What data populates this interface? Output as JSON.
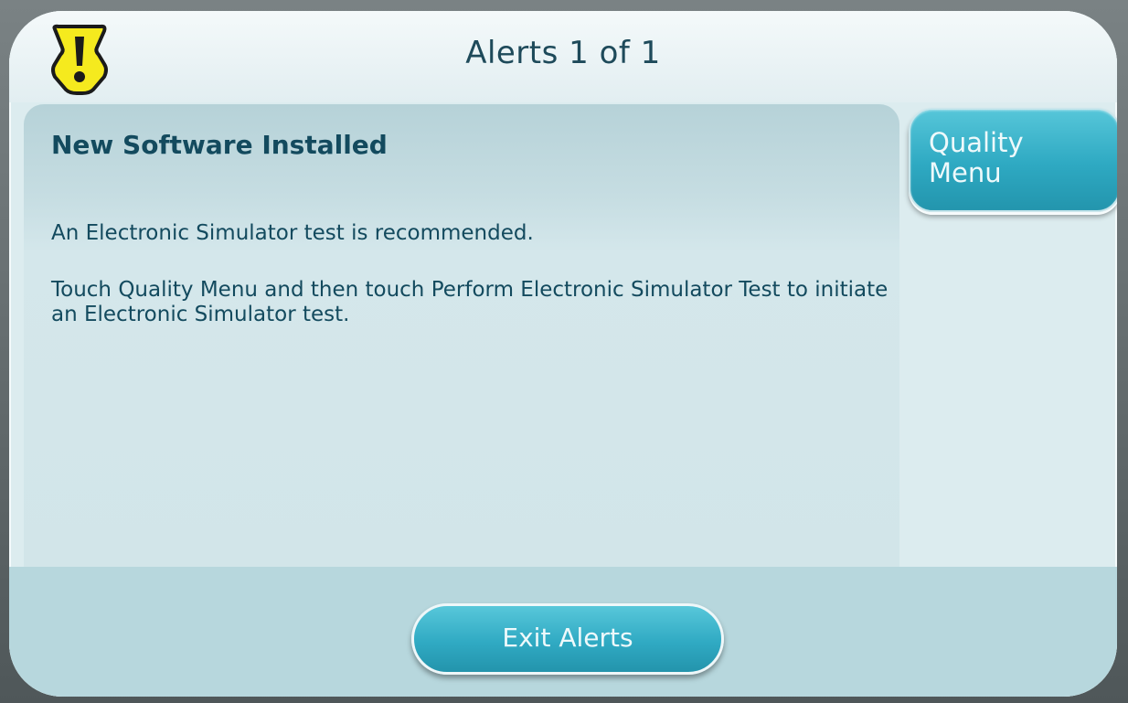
{
  "header": {
    "title": "Alerts  1 of 1",
    "icon": "warning-icon",
    "icon_color": "#f5ea1e"
  },
  "alert": {
    "heading": "New Software Installed",
    "line1": "An Electronic Simulator test is recommended.",
    "line2": "Touch Quality Menu and then touch Perform Electronic Simulator Test to initiate an Electronic Simulator test."
  },
  "buttons": {
    "quality_menu": "Quality Menu",
    "exit_alerts": "Exit Alerts"
  },
  "colors": {
    "accent": "#2ea9c2",
    "text": "#134a5e",
    "background": "#dcecef"
  }
}
